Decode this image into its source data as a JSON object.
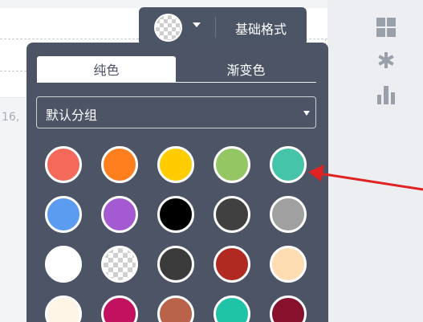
{
  "canvas": {
    "side_text": "16,"
  },
  "toolbar": {
    "format_label": "基础格式",
    "swatch_icon": "transparent-swatch",
    "caret_icon": "caret-down-icon"
  },
  "right_toolbar": {
    "icons": [
      "grid-icon",
      "asterisk-icon",
      "bar-chart-icon"
    ]
  },
  "color_panel": {
    "tabs": [
      {
        "label": "纯色",
        "active": true
      },
      {
        "label": "渐变色",
        "active": false
      }
    ],
    "group_select": {
      "value": "默认分组"
    },
    "swatches": [
      [
        "#f4695a",
        "#ff7f1e",
        "#ffcc00",
        "#94c764",
        "#45c4aa"
      ],
      [
        "#5b9cf0",
        "#a45ad0",
        "#000000",
        "#404040",
        "#a0a0a0"
      ],
      [
        "#ffffff",
        "transparent",
        "#3b3b3b",
        "#b02a22",
        "#fcdcb0"
      ],
      [
        "#fff5e6",
        "#c2115f",
        "#b8634a",
        "#1fc4a6",
        "#87112c"
      ]
    ]
  },
  "annotation": {
    "arrow_color": "#e02222"
  }
}
